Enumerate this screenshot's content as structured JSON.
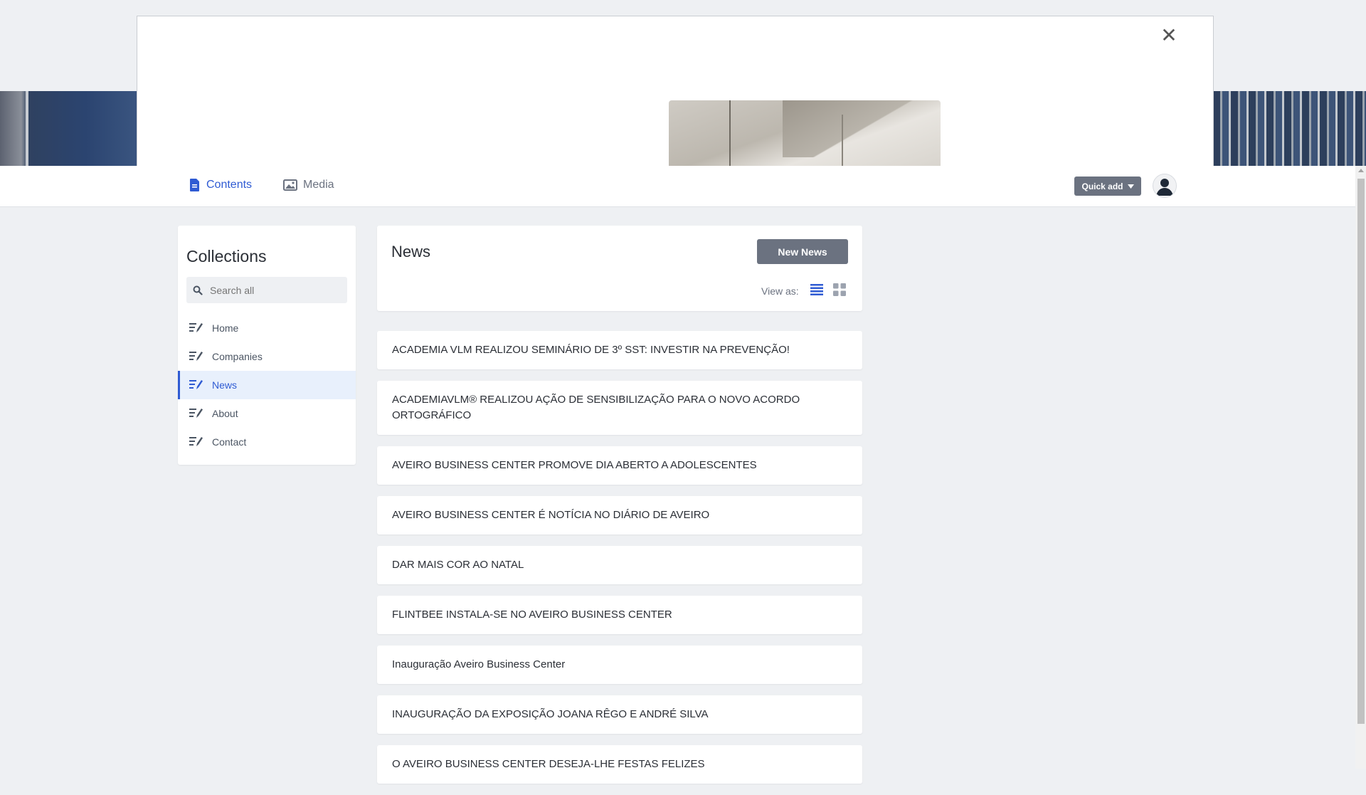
{
  "modal": {
    "close_symbol": "✕"
  },
  "topnav": {
    "tabs": [
      {
        "label": "Contents",
        "icon": "document-icon"
      },
      {
        "label": "Media",
        "icon": "image-icon"
      }
    ],
    "quick_add_label": "Quick add"
  },
  "sidebar": {
    "title": "Collections",
    "search_placeholder": "Search all",
    "items": [
      {
        "label": "Home"
      },
      {
        "label": "Companies"
      },
      {
        "label": "News",
        "active": true
      },
      {
        "label": "About"
      },
      {
        "label": "Contact"
      }
    ]
  },
  "main": {
    "title": "News",
    "new_button_label": "New News",
    "view_as_label": "View as:",
    "items": [
      "ACADEMIA VLM REALIZOU SEMINÁRIO DE 3º SST: INVESTIR NA PREVENÇÃO!",
      "ACADEMIAVLM® REALIZOU AÇÃO DE SENSIBILIZAÇÃO PARA O NOVO ACORDO ORTOGRÁFICO",
      "AVEIRO BUSINESS CENTER PROMOVE DIA ABERTO A ADOLESCENTES",
      "AVEIRO BUSINESS CENTER É NOTÍCIA NO DIÁRIO DE AVEIRO",
      "DAR MAIS COR AO NATAL",
      "FLINTBEE INSTALA-SE NO AVEIRO BUSINESS CENTER",
      "Inauguração Aveiro Business Center",
      "INAUGURAÇÃO DA EXPOSIÇÃO JOANA RÊGO E ANDRÉ SILVA",
      "O AVEIRO BUSINESS CENTER DESEJA-LHE FESTAS FELIZES"
    ]
  },
  "colors": {
    "accent": "#2f5bd3",
    "button": "#6b7280",
    "background": "#eef0f3"
  }
}
